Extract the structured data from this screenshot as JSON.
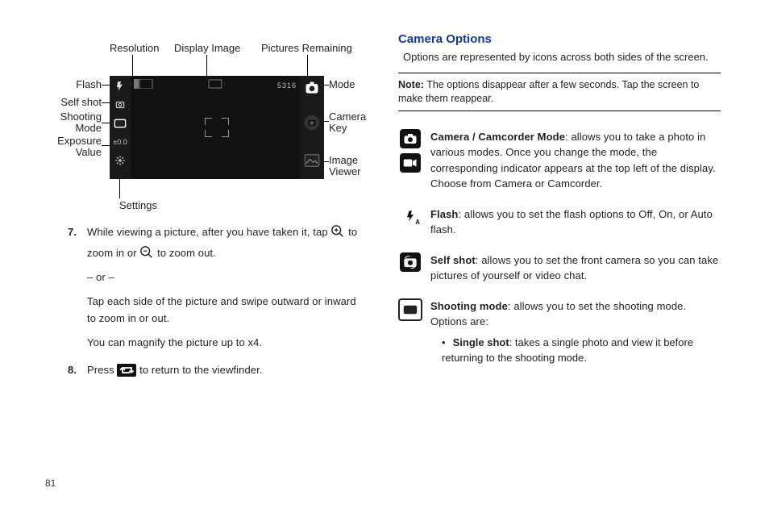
{
  "page_number": "81",
  "diagram": {
    "top": {
      "resolution": "Resolution",
      "display_image": "Display Image",
      "pictures_remaining": "Pictures Remaining"
    },
    "left": {
      "flash": "Flash",
      "self_shot": "Self shot",
      "shooting_mode": "Shooting\nMode",
      "exposure_value": "Exposure\nValue"
    },
    "right": {
      "mode": "Mode",
      "camera_key": "Camera\nKey",
      "image_viewer": "Image\nViewer"
    },
    "bottom": {
      "settings": "Settings"
    },
    "viewfinder": {
      "count": "5316"
    }
  },
  "steps": {
    "s7": {
      "num": "7.",
      "line1a": "While viewing a picture, after you have taken it, tap ",
      "line1b": " to",
      "line2a": "zoom in or ",
      "line2b": " to zoom out.",
      "alt": "– or –",
      "p2": "Tap each side of the picture and swipe outward or inward to zoom in or out.",
      "p3": "You can magnify the picture up to x4."
    },
    "s8": {
      "num": "8.",
      "a": "Press ",
      "b": " to return to the viewfinder."
    }
  },
  "right": {
    "heading": "Camera Options",
    "intro": "Options are represented by icons across both sides of the screen.",
    "note_label": "Note:",
    "note_body": "The options disappear after a few seconds. Tap the screen to make them reappear.",
    "mode": {
      "title": "Camera / Camcorder Mode",
      "body": ": allows you to take a photo in various modes. Once you change the mode, the corresponding indicator appears at the top left of the display. Choose from Camera or Camcorder."
    },
    "flash": {
      "title": "Flash",
      "body": ": allows you to set the flash options to Off, On, or Auto flash."
    },
    "self": {
      "title": "Self shot",
      "body": ": allows you to set the front camera so you can take pictures of yourself or video chat."
    },
    "shooting": {
      "title": "Shooting mode",
      "body": ": allows you to set the shooting mode. Options are:"
    },
    "bullet": {
      "title": "Single shot",
      "body": ": takes a single photo and view it before returning to the shooting mode."
    }
  }
}
